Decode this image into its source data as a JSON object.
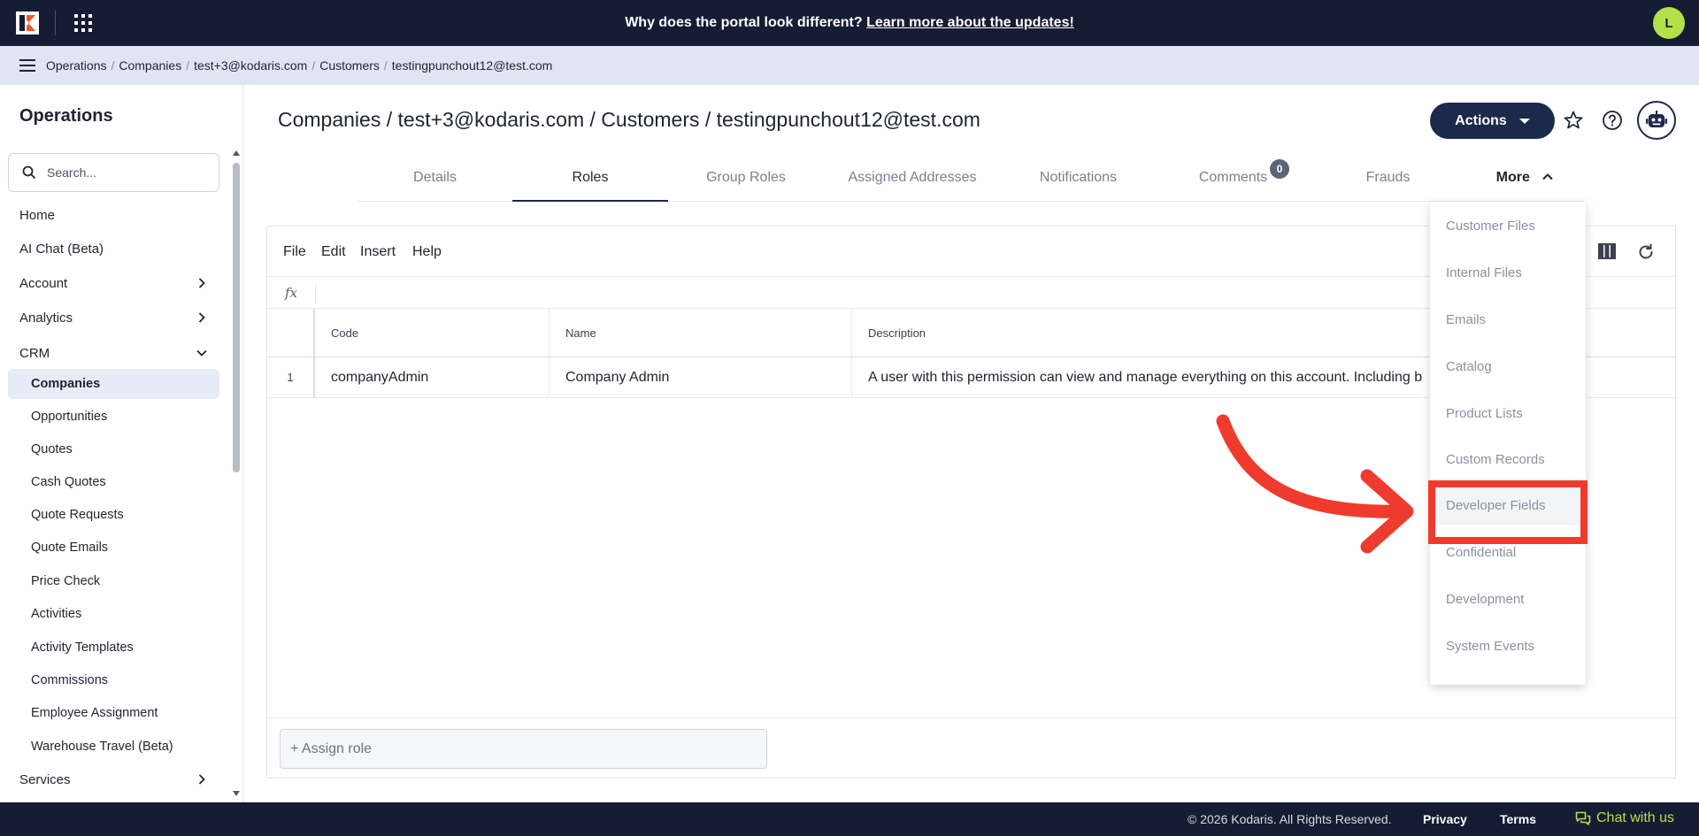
{
  "topbar": {
    "announcement": "Why does the portal look different?",
    "announcement_link": "Learn more about the updates!",
    "avatar_initial": "L"
  },
  "breadcrumb": [
    "Operations",
    "Companies",
    "test+3@kodaris.com",
    "Customers",
    "testingpunchout12@test.com"
  ],
  "sidebar": {
    "title": "Operations",
    "search_placeholder": "Search...",
    "items": [
      {
        "label": "Home"
      },
      {
        "label": "AI Chat (Beta)"
      },
      {
        "label": "Account"
      },
      {
        "label": "Analytics"
      },
      {
        "label": "CRM"
      },
      {
        "label": "Companies"
      },
      {
        "label": "Opportunities"
      },
      {
        "label": "Quotes"
      },
      {
        "label": "Cash Quotes"
      },
      {
        "label": "Quote Requests"
      },
      {
        "label": "Quote Emails"
      },
      {
        "label": "Price Check"
      },
      {
        "label": "Activities"
      },
      {
        "label": "Activity Templates"
      },
      {
        "label": "Commissions"
      },
      {
        "label": "Employee Assignment"
      },
      {
        "label": "Warehouse Travel (Beta)"
      },
      {
        "label": "Services"
      }
    ]
  },
  "main": {
    "title": "Companies / test+3@kodaris.com / Customers / testingpunchout12@test.com",
    "actions_label": "Actions",
    "tabs": [
      {
        "label": "Details"
      },
      {
        "label": "Roles"
      },
      {
        "label": "Group Roles"
      },
      {
        "label": "Assigned Addresses"
      },
      {
        "label": "Notifications"
      },
      {
        "label": "Comments",
        "badge": "0"
      },
      {
        "label": "Frauds"
      },
      {
        "label": "More"
      }
    ]
  },
  "grid": {
    "menus": [
      "File",
      "Edit",
      "Insert",
      "Help"
    ],
    "fx_label": "fx",
    "columns": [
      "Code",
      "Name",
      "Description"
    ],
    "rows": [
      {
        "num": "1",
        "code": "companyAdmin",
        "name": "Company Admin",
        "description": "A user with this permission can view and manage everything on this account. Including b"
      }
    ],
    "assign_placeholder": "+ Assign role"
  },
  "more_menu": {
    "items": [
      "Customer Files",
      "Internal Files",
      "Emails",
      "Catalog",
      "Product Lists",
      "Custom Records",
      "Developer Fields",
      "Confidential",
      "Development",
      "System Events"
    ]
  },
  "footer": {
    "copyright": "© 2026 Kodaris. All Rights Reserved.",
    "privacy": "Privacy",
    "terms": "Terms",
    "chat": "Chat with us"
  },
  "colors": {
    "topbar": "#151c33",
    "accent": "#1b2a4a",
    "avatar": "#b5e04a",
    "highlight": "#ef3b2d"
  }
}
